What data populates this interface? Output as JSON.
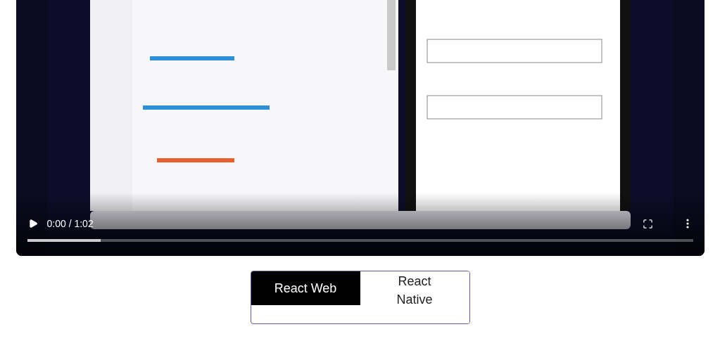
{
  "video": {
    "time": "0:00 / 1:02",
    "progress": {
      "level": 0.11
    }
  },
  "tabs": [
    {
      "label": "React Web",
      "selected": true
    },
    {
      "label": "React Native",
      "selected": false
    }
  ]
}
